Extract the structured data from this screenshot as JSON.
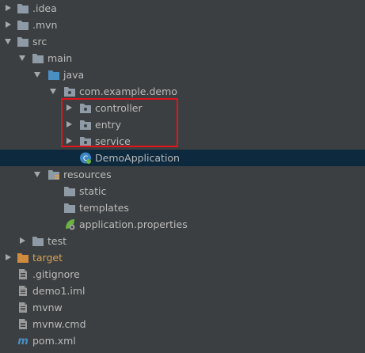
{
  "tree": {
    "items": [
      {
        "label": ".idea"
      },
      {
        "label": ".mvn"
      },
      {
        "label": "src"
      },
      {
        "label": "main"
      },
      {
        "label": "java"
      },
      {
        "label": "com.example.demo"
      },
      {
        "label": "controller"
      },
      {
        "label": "entry"
      },
      {
        "label": "service"
      },
      {
        "label": "DemoApplication"
      },
      {
        "label": "resources"
      },
      {
        "label": "static"
      },
      {
        "label": "templates"
      },
      {
        "label": "application.properties"
      },
      {
        "label": "test"
      },
      {
        "label": "target"
      },
      {
        "label": ".gitignore"
      },
      {
        "label": "demo1.iml"
      },
      {
        "label": "mvnw"
      },
      {
        "label": "mvnw.cmd"
      },
      {
        "label": "pom.xml"
      }
    ]
  },
  "colors": {
    "background": "#3c3f41",
    "selection": "#0d293e",
    "text": "#bbbbbb",
    "excluded_folder_text": "#d4a159",
    "highlight_border": "#e0141a",
    "folder_icon": "#8e9ba6",
    "source_folder_icon": "#4a8fc2"
  },
  "icons": [
    "folder-icon",
    "source-folder-icon",
    "resources-folder-icon",
    "package-icon",
    "spring-class-icon",
    "spring-properties-icon",
    "excluded-folder-icon",
    "file-icon",
    "maven-icon"
  ]
}
